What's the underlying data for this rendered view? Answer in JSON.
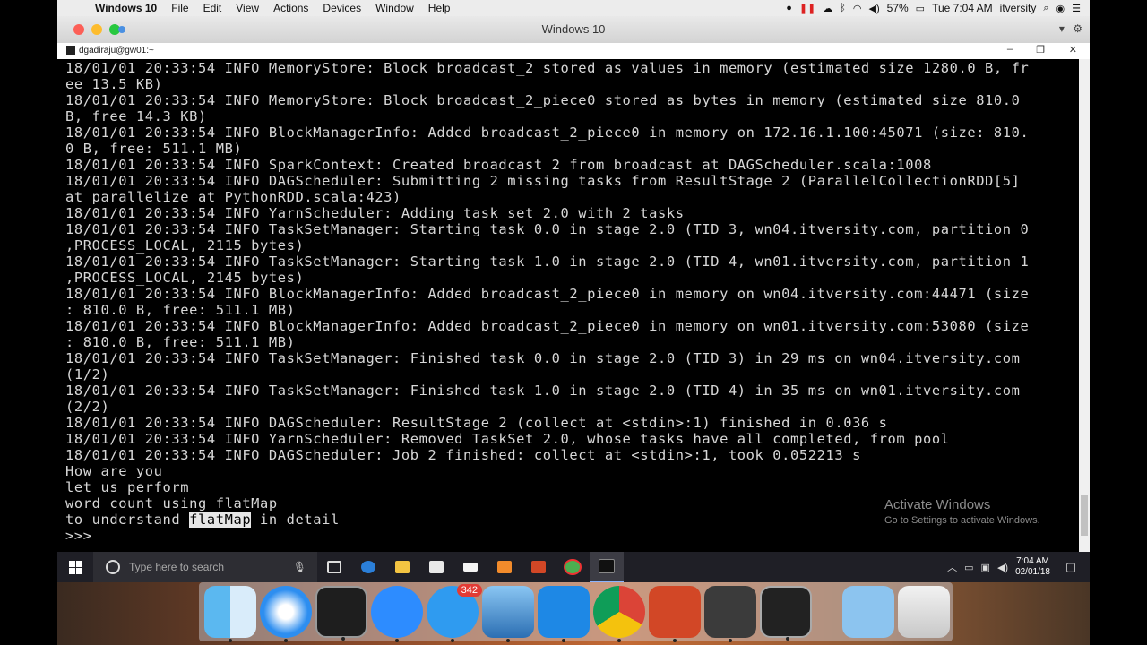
{
  "menubar": {
    "app_name": "Windows 10",
    "menus": [
      "File",
      "Edit",
      "View",
      "Actions",
      "Devices",
      "Window",
      "Help"
    ],
    "battery": "57%",
    "clock": "Tue 7:04 AM",
    "user": "itversity"
  },
  "vm_window": {
    "title": "Windows 10"
  },
  "terminal": {
    "title": "dgadiraju@gw01:~",
    "lines": [
      "18/01/01 20:33:54 INFO MemoryStore: Block broadcast_2 stored as values in memory (estimated size 1280.0 B, fr",
      "ee 13.5 KB)",
      "18/01/01 20:33:54 INFO MemoryStore: Block broadcast_2_piece0 stored as bytes in memory (estimated size 810.0",
      "B, free 14.3 KB)",
      "18/01/01 20:33:54 INFO BlockManagerInfo: Added broadcast_2_piece0 in memory on 172.16.1.100:45071 (size: 810.",
      "0 B, free: 511.1 MB)",
      "18/01/01 20:33:54 INFO SparkContext: Created broadcast 2 from broadcast at DAGScheduler.scala:1008",
      "18/01/01 20:33:54 INFO DAGScheduler: Submitting 2 missing tasks from ResultStage 2 (ParallelCollectionRDD[5]",
      "at parallelize at PythonRDD.scala:423)",
      "18/01/01 20:33:54 INFO YarnScheduler: Adding task set 2.0 with 2 tasks",
      "18/01/01 20:33:54 INFO TaskSetManager: Starting task 0.0 in stage 2.0 (TID 3, wn04.itversity.com, partition 0",
      ",PROCESS_LOCAL, 2115 bytes)",
      "18/01/01 20:33:54 INFO TaskSetManager: Starting task 1.0 in stage 2.0 (TID 4, wn01.itversity.com, partition 1",
      ",PROCESS_LOCAL, 2145 bytes)",
      "18/01/01 20:33:54 INFO BlockManagerInfo: Added broadcast_2_piece0 in memory on wn04.itversity.com:44471 (size",
      ": 810.0 B, free: 511.1 MB)",
      "18/01/01 20:33:54 INFO BlockManagerInfo: Added broadcast_2_piece0 in memory on wn01.itversity.com:53080 (size",
      ": 810.0 B, free: 511.1 MB)",
      "18/01/01 20:33:54 INFO TaskSetManager: Finished task 0.0 in stage 2.0 (TID 3) in 29 ms on wn04.itversity.com",
      "(1/2)",
      "18/01/01 20:33:54 INFO TaskSetManager: Finished task 1.0 in stage 2.0 (TID 4) in 35 ms on wn01.itversity.com",
      "(2/2)",
      "18/01/01 20:33:54 INFO DAGScheduler: ResultStage 2 (collect at <stdin>:1) finished in 0.036 s",
      "18/01/01 20:33:54 INFO YarnScheduler: Removed TaskSet 2.0, whose tasks have all completed, from pool",
      "18/01/01 20:33:54 INFO DAGScheduler: Job 2 finished: collect at <stdin>:1, took 0.052213 s",
      "How are you",
      "let us perform",
      "word count using flatMap"
    ],
    "last_line_before": "to understand ",
    "last_line_selected": "flatMap",
    "last_line_after": " in detail",
    "prompt": ">>>"
  },
  "watermark": {
    "title": "Activate Windows",
    "subtitle": "Go to Settings to activate Windows."
  },
  "taskbar": {
    "search_placeholder": "Type here to search",
    "time": "7:04 AM",
    "date": "02/01/18"
  },
  "dock": {
    "badge": "342"
  },
  "colors": {
    "terminal_bg": "#000000",
    "terminal_fg": "#d7d7d7",
    "taskbar": "#1f1f26"
  }
}
